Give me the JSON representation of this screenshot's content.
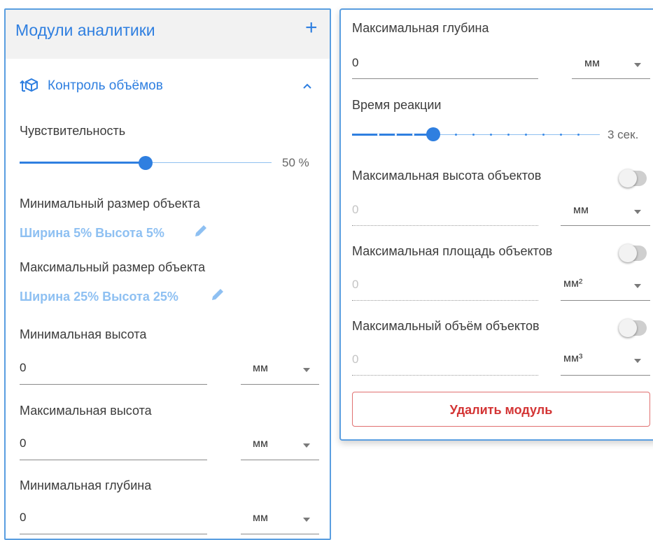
{
  "header": {
    "title": "Модули аналитики",
    "add_label": "+"
  },
  "module": {
    "title": "Контроль объёмов",
    "sensitivity": {
      "label": "Чувствительность",
      "value": 50,
      "value_text": "50 %"
    },
    "min_size": {
      "label": "Минимальный размер объекта",
      "value_text": "Ширина 5% Высота 5%"
    },
    "max_size": {
      "label": "Максимальный размер объекта",
      "value_text": "Ширина 25% Высота 25%"
    },
    "min_height": {
      "label": "Минимальная высота",
      "value": "0",
      "unit": "мм"
    },
    "max_height": {
      "label": "Максимальная высота",
      "value": "0",
      "unit": "мм"
    },
    "min_depth": {
      "label": "Минимальная глубина",
      "value": "0",
      "unit": "мм"
    },
    "max_depth": {
      "label": "Максимальная глубина",
      "value": "0",
      "unit": "мм"
    },
    "reaction_time": {
      "label": "Время реакции",
      "value": 3,
      "min": 0,
      "max": 10,
      "value_text": "3 сек."
    },
    "max_object_height": {
      "label": "Максимальная высота объектов",
      "enabled": false,
      "value": "0",
      "unit": "мм"
    },
    "max_object_area": {
      "label": "Максимальная площадь объектов",
      "enabled": false,
      "value": "0",
      "unit": "мм²"
    },
    "max_object_volume": {
      "label": "Максимальный объём объектов",
      "enabled": false,
      "value": "0",
      "unit": "мм³"
    },
    "delete_label": "Удалить модуль"
  },
  "colors": {
    "accent": "#2f7fe0",
    "link": "#8ec0f2",
    "danger": "#d33434"
  }
}
